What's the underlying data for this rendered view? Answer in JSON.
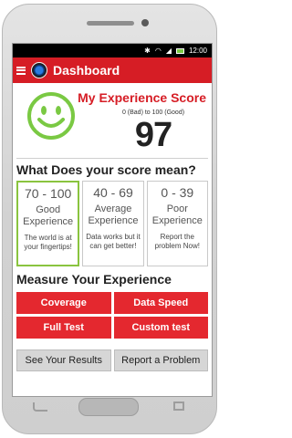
{
  "status_bar": {
    "time": "12:00",
    "icons": [
      "bluetooth-icon",
      "wifi-icon",
      "signal-icon",
      "battery-icon"
    ]
  },
  "app_bar": {
    "title": "Dashboard",
    "color": "#d61d25"
  },
  "score": {
    "title": "My Experience Score",
    "range": "0 (Bad) to 100 (Good)",
    "value": "97",
    "icon": "smiley-face-icon",
    "icon_color": "#7ac943"
  },
  "meaning": {
    "title": "What Does your score mean?",
    "cards": [
      {
        "range": "70 - 100",
        "label_line1": "Good",
        "label_line2": "Experience",
        "desc_line1": "The world is at",
        "desc_line2": "your fingertips!"
      },
      {
        "range": "40 - 69",
        "label_line1": "Average",
        "label_line2": "Experience",
        "desc_line1": "Data works but it",
        "desc_line2": "can get better!"
      },
      {
        "range": "0 - 39",
        "label_line1": "Poor",
        "label_line2": "Experience",
        "desc_line1": "Report the",
        "desc_line2": "problem Now!"
      }
    ]
  },
  "measure": {
    "title": "Measure Your Experience",
    "buttons": [
      "Coverage",
      "Data Speed",
      "Full Test",
      "Custom test"
    ]
  },
  "bottom": {
    "see_results": "See Your Results",
    "report_problem": "Report a Problem"
  }
}
